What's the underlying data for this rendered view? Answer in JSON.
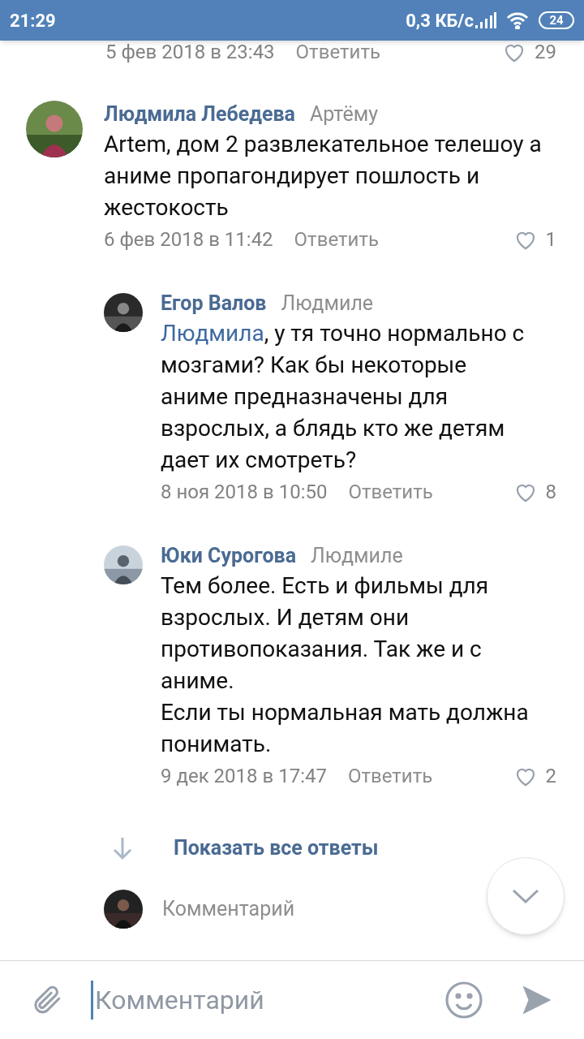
{
  "status_bar": {
    "time": "21:29",
    "speed": "0,3 КБ/с",
    "battery": "24"
  },
  "top_meta": {
    "date": "5 фев 2018 в 23:43",
    "reply": "Ответить",
    "likes": "29"
  },
  "comments": [
    {
      "kind": "comment",
      "author": "Людмила Лебедева",
      "to": "Артёму",
      "text": "Artem, дом 2 развлекательное телешоу а аниме пропагондирует пошлость и жестокость",
      "date": "6 фев 2018 в 11:42",
      "reply": "Ответить",
      "likes": "1"
    },
    {
      "kind": "reply",
      "author": "Егор Валов",
      "to": "Людмиле",
      "mention": "Людмила",
      "text": ", у тя точно нормально с мозгами? Как бы некоторые аниме предназначены для взрослых, а блядь кто же детям дает их смотреть?",
      "date": "8 ноя 2018 в 10:50",
      "reply": "Ответить",
      "likes": "8"
    },
    {
      "kind": "reply",
      "author": "Юки Сурогова",
      "to": "Людмиле",
      "text": "Тем более. Есть и фильмы для взрослых. И детям они противопоказания. Так же и с аниме.\nЕсли ты нормальная мать должна понимать.",
      "date": "9 дек 2018 в 17:47",
      "reply": "Ответить",
      "likes": "2"
    }
  ],
  "show_all": "Показать все ответы",
  "reply_field": {
    "placeholder": "Комментарий"
  },
  "composer": {
    "placeholder": "Комментарий"
  }
}
